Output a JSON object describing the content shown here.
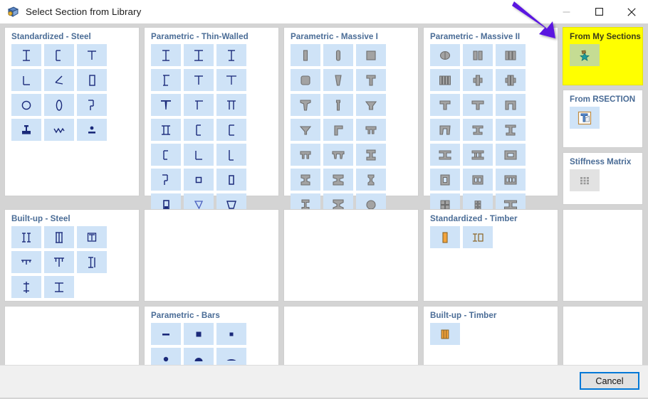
{
  "window": {
    "title": "Select Section from Library",
    "icon": "library-section-icon",
    "minimize_label": "Minimize",
    "maximize_label": "Maximize",
    "close_label": "Close"
  },
  "footer": {
    "cancel_label": "Cancel"
  },
  "annotation": {
    "arrow_color": "#5a14e0",
    "points_to": "From My Sections"
  },
  "panels": [
    {
      "id": "standardized-steel",
      "title": "Standardized - Steel",
      "style": "steel",
      "tiles": 12,
      "more": false
    },
    {
      "id": "parametric-thin-walled",
      "title": "Parametric - Thin-Walled",
      "style": "steel",
      "tiles": 23,
      "more": true
    },
    {
      "id": "parametric-massive-i",
      "title": "Parametric - Massive I",
      "style": "grey",
      "tiles": 23,
      "more": true
    },
    {
      "id": "parametric-massive-ii",
      "title": "Parametric - Massive II",
      "style": "grey",
      "tiles": 23,
      "more": false
    },
    {
      "id": "built-up-steel",
      "title": "Built-up - Steel",
      "style": "steel",
      "tiles": 8,
      "more": false
    },
    {
      "id": "blank-r2c2",
      "title": "",
      "style": "blank",
      "tiles": 0,
      "more": false
    },
    {
      "id": "blank-r2c3",
      "title": "",
      "style": "blank",
      "tiles": 0,
      "more": false
    },
    {
      "id": "standardized-timber",
      "title": "Standardized - Timber",
      "style": "timber",
      "tiles": 2,
      "more": false
    },
    {
      "id": "blank-r3c1",
      "title": "",
      "style": "blank",
      "tiles": 0,
      "more": false
    },
    {
      "id": "parametric-bars",
      "title": "Parametric - Bars",
      "style": "steel",
      "tiles": 8,
      "more": false
    },
    {
      "id": "blank-r3c3",
      "title": "",
      "style": "blank",
      "tiles": 0,
      "more": false
    },
    {
      "id": "built-up-timber",
      "title": "Built-up - Timber",
      "style": "timber",
      "tiles": 1,
      "more": false
    }
  ],
  "side_cards": [
    {
      "id": "from-my-sections",
      "title": "From My Sections",
      "highlighted": true,
      "icon": "star-section-icon",
      "icon_bg": "green"
    },
    {
      "id": "from-rsection",
      "title": "From RSECTION",
      "highlighted": false,
      "icon": "rsection-icon",
      "icon_bg": "blue"
    },
    {
      "id": "stiffness-matrix",
      "title": "Stiffness Matrix",
      "highlighted": false,
      "icon": "matrix-grid-icon",
      "icon_bg": "grey"
    }
  ]
}
